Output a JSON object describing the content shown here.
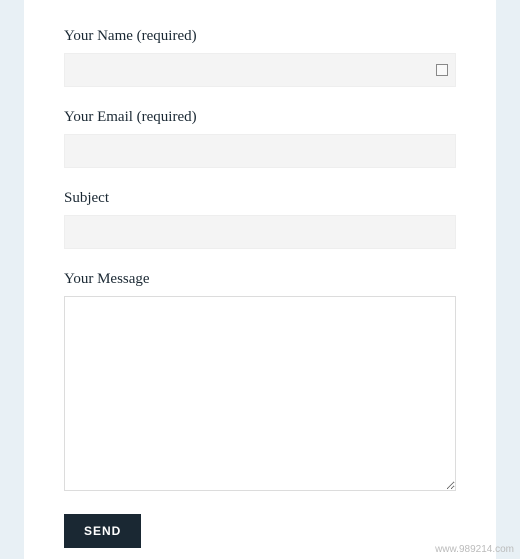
{
  "form": {
    "name": {
      "label": "Your Name (required)",
      "value": ""
    },
    "email": {
      "label": "Your Email (required)",
      "value": ""
    },
    "subject": {
      "label": "Subject",
      "value": ""
    },
    "message": {
      "label": "Your Message",
      "value": ""
    },
    "submit_label": "SEND"
  },
  "watermark": "www.989214.com"
}
